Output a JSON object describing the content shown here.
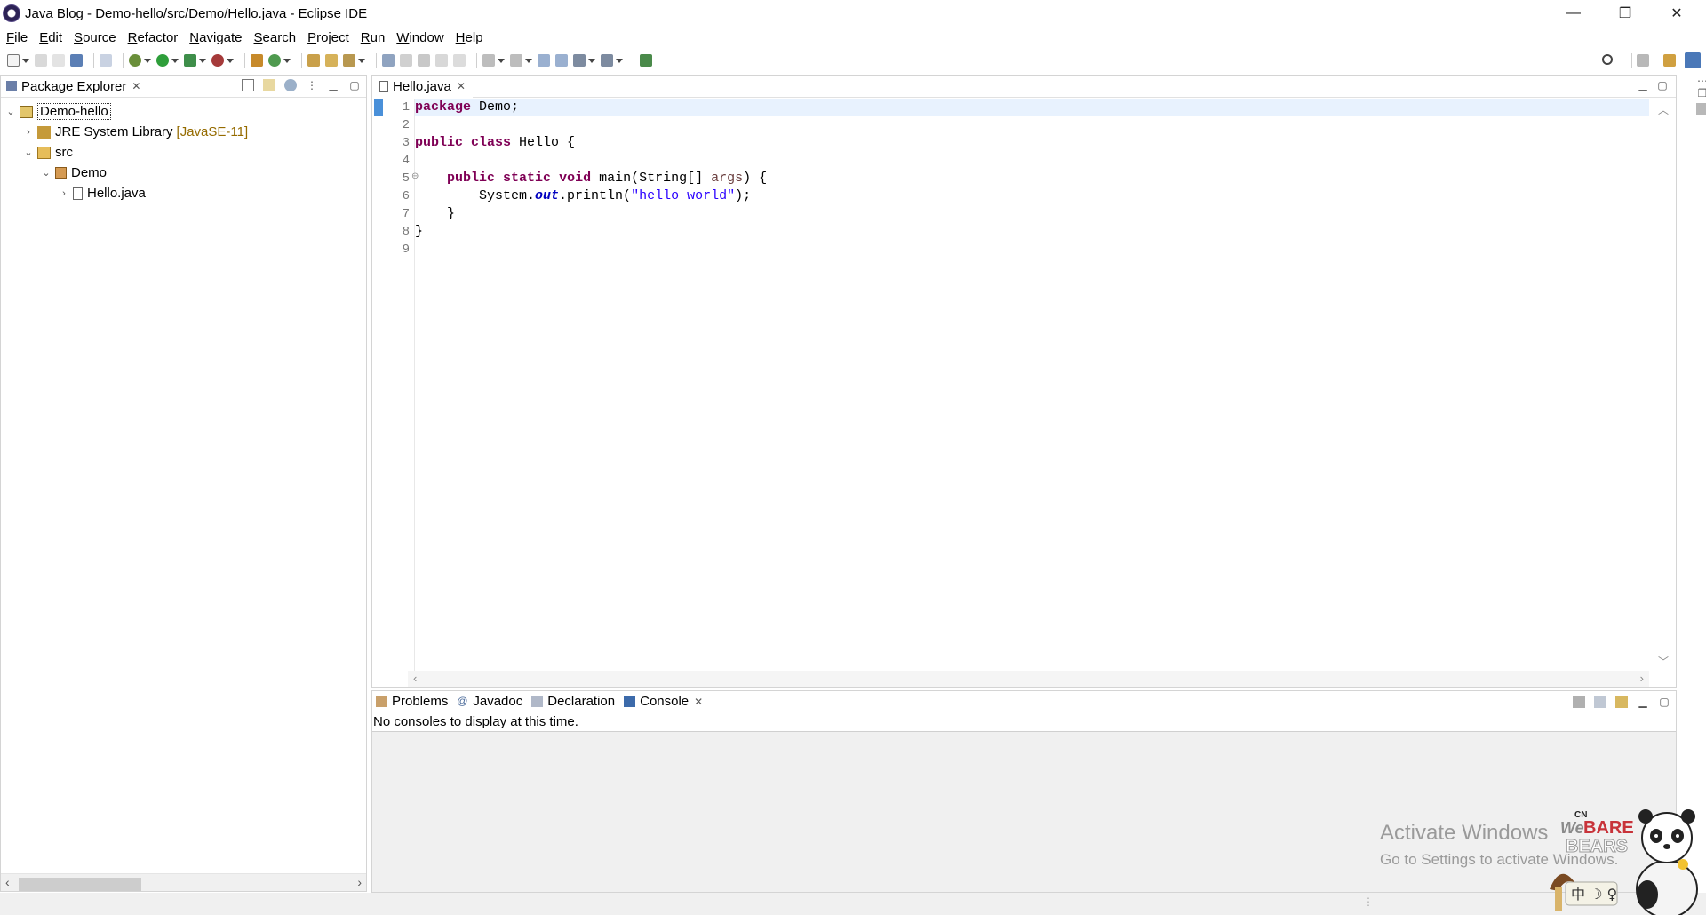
{
  "window": {
    "title": "Java Blog - Demo-hello/src/Demo/Hello.java - Eclipse IDE",
    "controls": [
      "—",
      "❐",
      "✕"
    ]
  },
  "menu": [
    "File",
    "Edit",
    "Source",
    "Refactor",
    "Navigate",
    "Search",
    "Project",
    "Run",
    "Window",
    "Help"
  ],
  "package_explorer": {
    "title": "Package Explorer",
    "tree": [
      {
        "label": "Demo-hello",
        "level": 0,
        "expanded": true,
        "icon": "project-icon"
      },
      {
        "label": "JRE System Library",
        "decoration": "[JavaSE-11]",
        "level": 1,
        "expanded": false,
        "icon": "library-icon"
      },
      {
        "label": "src",
        "level": 1,
        "expanded": true,
        "icon": "source-folder-icon"
      },
      {
        "label": "Demo",
        "level": 2,
        "expanded": true,
        "icon": "package-icon"
      },
      {
        "label": "Hello.java",
        "level": 3,
        "expanded": false,
        "icon": "java-file-icon"
      }
    ]
  },
  "editor": {
    "tab": "Hello.java",
    "line_numbers": [
      "1",
      "2",
      "3",
      "4",
      "5",
      "6",
      "7",
      "8",
      "9"
    ],
    "code": {
      "l1_kw": "package",
      "l1_rest": " Demo;",
      "l3_kw1": "public",
      "l3_kw2": "class",
      "l3_rest": " Hello {",
      "l5_indent": "    ",
      "l5_kw1": "public",
      "l5_kw2": "static",
      "l5_kw3": "void",
      "l5_rest1": " main(String[] ",
      "l5_param": "args",
      "l5_rest2": ") {",
      "l6_pre": "        System.",
      "l6_field": "out",
      "l6_mid": ".println(",
      "l6_str": "\"hello world\"",
      "l6_end": ");",
      "l7": "    }",
      "l8": "}"
    }
  },
  "bottom": {
    "tabs": [
      {
        "label": "Problems",
        "icon": "problems-icon"
      },
      {
        "label": "Javadoc",
        "icon": "javadoc-icon"
      },
      {
        "label": "Declaration",
        "icon": "declaration-icon"
      },
      {
        "label": "Console",
        "icon": "console-icon"
      }
    ],
    "active_tab": "Console",
    "message": "No consoles to display at this time."
  },
  "watermark": {
    "line1": "Activate Windows",
    "line2": "Go to Settings to activate Windows."
  },
  "sticker": {
    "brand_small": "CN",
    "brand_we": "We",
    "brand_bare": "BARE",
    "brand_bears": "BEARS",
    "badge": "中 ☽ ♀"
  },
  "colors": {
    "keyword": "#7f0055",
    "string": "#2a00ff",
    "field": "#0000c0",
    "current_line": "#e8f2fe",
    "decoration": "#956b00"
  }
}
